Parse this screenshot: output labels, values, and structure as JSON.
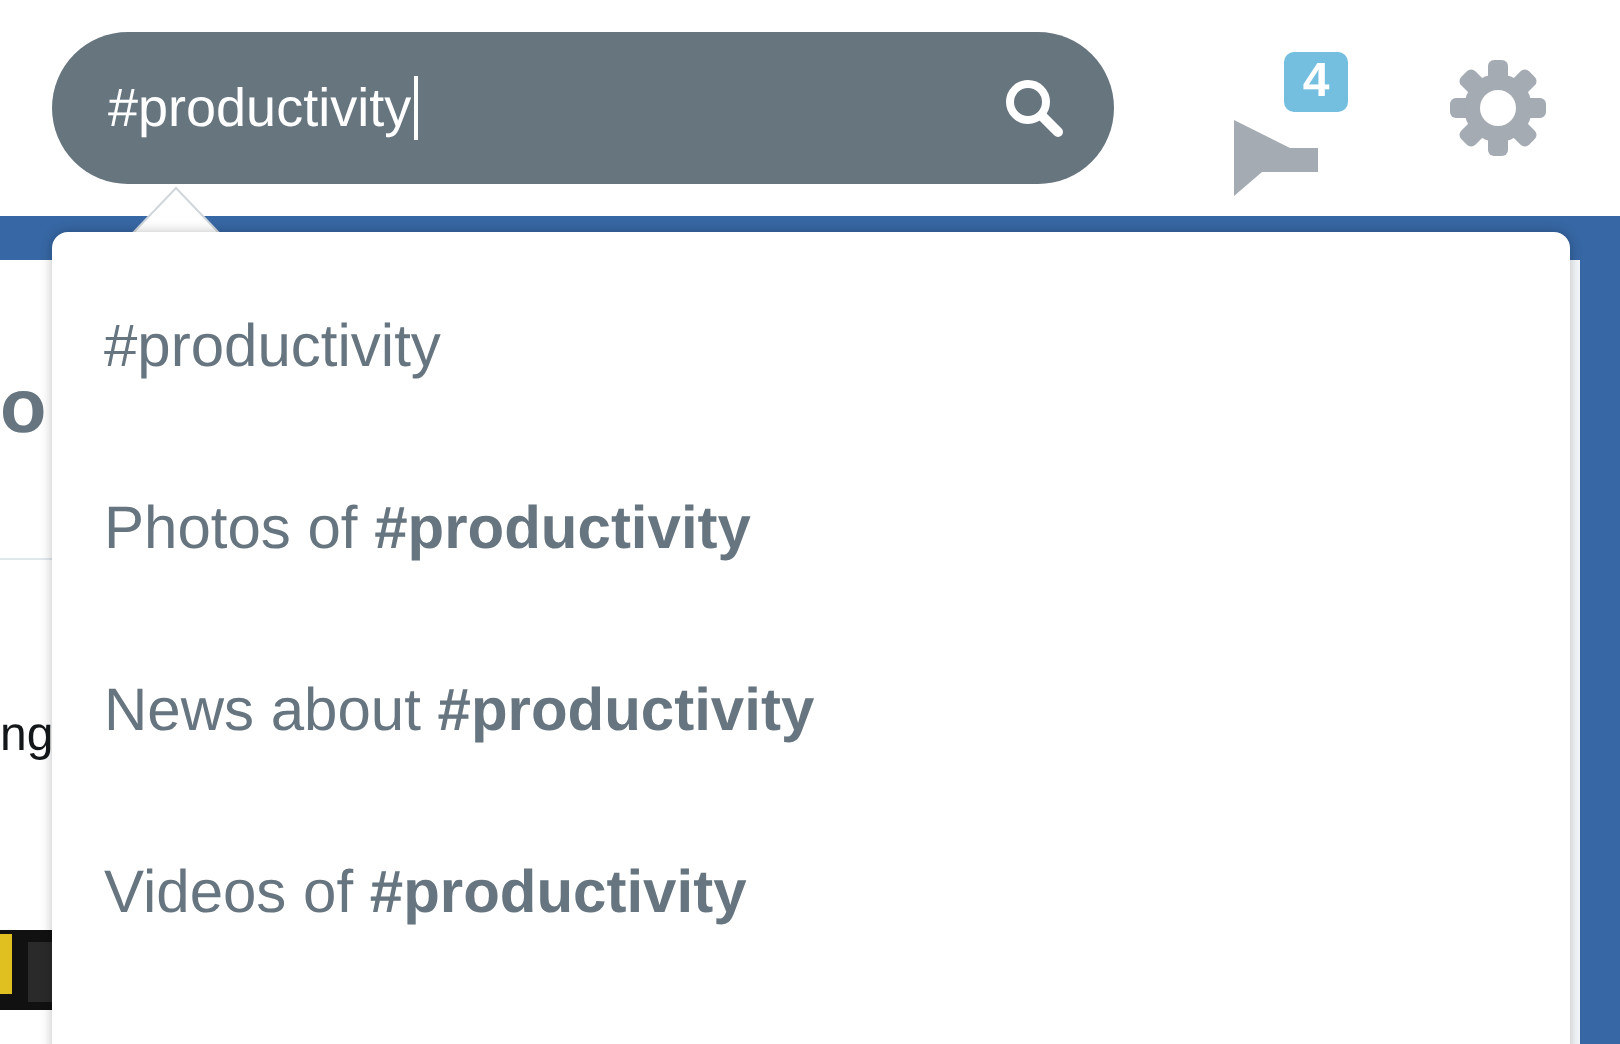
{
  "search": {
    "value": "#productivity",
    "focused": true
  },
  "messages": {
    "badge": "4"
  },
  "suggestions": [
    {
      "text": "#productivity"
    },
    {
      "text": "Photos of **#productivity**"
    },
    {
      "text": "News about **#productivity**"
    },
    {
      "text": "Videos of **#productivity**"
    }
  ],
  "background": {
    "heading": "o",
    "tweet": "ng"
  }
}
